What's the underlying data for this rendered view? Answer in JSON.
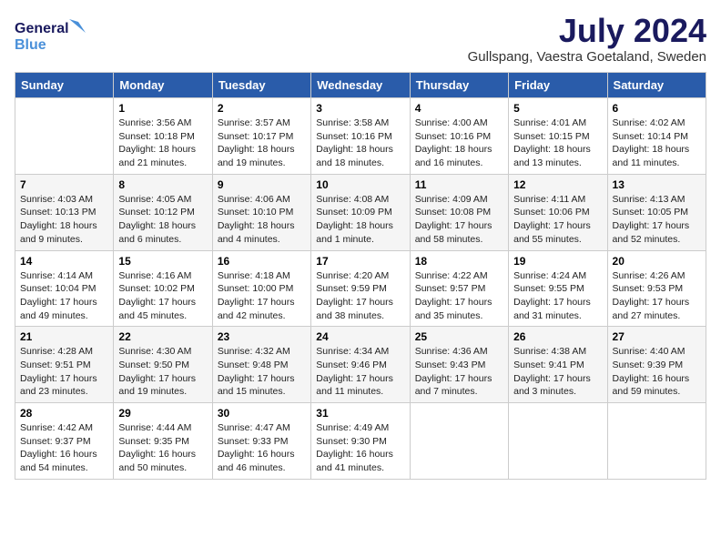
{
  "logo": {
    "line1": "General",
    "line2": "Blue"
  },
  "title": {
    "month_year": "July 2024",
    "location": "Gullspang, Vaestra Goetaland, Sweden"
  },
  "days_of_week": [
    "Sunday",
    "Monday",
    "Tuesday",
    "Wednesday",
    "Thursday",
    "Friday",
    "Saturday"
  ],
  "weeks": [
    [
      {
        "day": "",
        "content": ""
      },
      {
        "day": "1",
        "content": "Sunrise: 3:56 AM\nSunset: 10:18 PM\nDaylight: 18 hours\nand 21 minutes."
      },
      {
        "day": "2",
        "content": "Sunrise: 3:57 AM\nSunset: 10:17 PM\nDaylight: 18 hours\nand 19 minutes."
      },
      {
        "day": "3",
        "content": "Sunrise: 3:58 AM\nSunset: 10:16 PM\nDaylight: 18 hours\nand 18 minutes."
      },
      {
        "day": "4",
        "content": "Sunrise: 4:00 AM\nSunset: 10:16 PM\nDaylight: 18 hours\nand 16 minutes."
      },
      {
        "day": "5",
        "content": "Sunrise: 4:01 AM\nSunset: 10:15 PM\nDaylight: 18 hours\nand 13 minutes."
      },
      {
        "day": "6",
        "content": "Sunrise: 4:02 AM\nSunset: 10:14 PM\nDaylight: 18 hours\nand 11 minutes."
      }
    ],
    [
      {
        "day": "7",
        "content": "Sunrise: 4:03 AM\nSunset: 10:13 PM\nDaylight: 18 hours\nand 9 minutes."
      },
      {
        "day": "8",
        "content": "Sunrise: 4:05 AM\nSunset: 10:12 PM\nDaylight: 18 hours\nand 6 minutes."
      },
      {
        "day": "9",
        "content": "Sunrise: 4:06 AM\nSunset: 10:10 PM\nDaylight: 18 hours\nand 4 minutes."
      },
      {
        "day": "10",
        "content": "Sunrise: 4:08 AM\nSunset: 10:09 PM\nDaylight: 18 hours\nand 1 minute."
      },
      {
        "day": "11",
        "content": "Sunrise: 4:09 AM\nSunset: 10:08 PM\nDaylight: 17 hours\nand 58 minutes."
      },
      {
        "day": "12",
        "content": "Sunrise: 4:11 AM\nSunset: 10:06 PM\nDaylight: 17 hours\nand 55 minutes."
      },
      {
        "day": "13",
        "content": "Sunrise: 4:13 AM\nSunset: 10:05 PM\nDaylight: 17 hours\nand 52 minutes."
      }
    ],
    [
      {
        "day": "14",
        "content": "Sunrise: 4:14 AM\nSunset: 10:04 PM\nDaylight: 17 hours\nand 49 minutes."
      },
      {
        "day": "15",
        "content": "Sunrise: 4:16 AM\nSunset: 10:02 PM\nDaylight: 17 hours\nand 45 minutes."
      },
      {
        "day": "16",
        "content": "Sunrise: 4:18 AM\nSunset: 10:00 PM\nDaylight: 17 hours\nand 42 minutes."
      },
      {
        "day": "17",
        "content": "Sunrise: 4:20 AM\nSunset: 9:59 PM\nDaylight: 17 hours\nand 38 minutes."
      },
      {
        "day": "18",
        "content": "Sunrise: 4:22 AM\nSunset: 9:57 PM\nDaylight: 17 hours\nand 35 minutes."
      },
      {
        "day": "19",
        "content": "Sunrise: 4:24 AM\nSunset: 9:55 PM\nDaylight: 17 hours\nand 31 minutes."
      },
      {
        "day": "20",
        "content": "Sunrise: 4:26 AM\nSunset: 9:53 PM\nDaylight: 17 hours\nand 27 minutes."
      }
    ],
    [
      {
        "day": "21",
        "content": "Sunrise: 4:28 AM\nSunset: 9:51 PM\nDaylight: 17 hours\nand 23 minutes."
      },
      {
        "day": "22",
        "content": "Sunrise: 4:30 AM\nSunset: 9:50 PM\nDaylight: 17 hours\nand 19 minutes."
      },
      {
        "day": "23",
        "content": "Sunrise: 4:32 AM\nSunset: 9:48 PM\nDaylight: 17 hours\nand 15 minutes."
      },
      {
        "day": "24",
        "content": "Sunrise: 4:34 AM\nSunset: 9:46 PM\nDaylight: 17 hours\nand 11 minutes."
      },
      {
        "day": "25",
        "content": "Sunrise: 4:36 AM\nSunset: 9:43 PM\nDaylight: 17 hours\nand 7 minutes."
      },
      {
        "day": "26",
        "content": "Sunrise: 4:38 AM\nSunset: 9:41 PM\nDaylight: 17 hours\nand 3 minutes."
      },
      {
        "day": "27",
        "content": "Sunrise: 4:40 AM\nSunset: 9:39 PM\nDaylight: 16 hours\nand 59 minutes."
      }
    ],
    [
      {
        "day": "28",
        "content": "Sunrise: 4:42 AM\nSunset: 9:37 PM\nDaylight: 16 hours\nand 54 minutes."
      },
      {
        "day": "29",
        "content": "Sunrise: 4:44 AM\nSunset: 9:35 PM\nDaylight: 16 hours\nand 50 minutes."
      },
      {
        "day": "30",
        "content": "Sunrise: 4:47 AM\nSunset: 9:33 PM\nDaylight: 16 hours\nand 46 minutes."
      },
      {
        "day": "31",
        "content": "Sunrise: 4:49 AM\nSunset: 9:30 PM\nDaylight: 16 hours\nand 41 minutes."
      },
      {
        "day": "",
        "content": ""
      },
      {
        "day": "",
        "content": ""
      },
      {
        "day": "",
        "content": ""
      }
    ]
  ]
}
